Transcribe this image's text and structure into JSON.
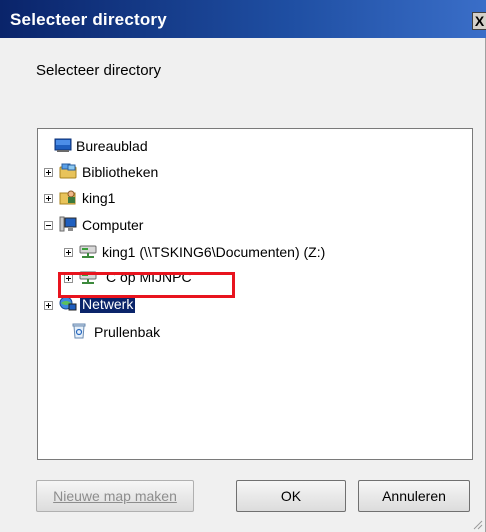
{
  "window": {
    "title": "Selecteer directory",
    "close_glyph": "X"
  },
  "prompt": "Selecteer directory",
  "tree": {
    "items": [
      {
        "label": "Bureaublad",
        "icon": "desktop-icon",
        "expander": "none"
      },
      {
        "label": "Bibliotheken",
        "icon": "libraries-icon",
        "expander": "plus"
      },
      {
        "label": "king1",
        "icon": "user-folder-icon",
        "expander": "plus"
      },
      {
        "label": "Computer",
        "icon": "computer-icon",
        "expander": "minus"
      },
      {
        "label": "king1 (\\\\TSKING6\\Documenten) (Z:)",
        "icon": "network-drive-icon",
        "expander": "plus"
      },
      {
        "label": "C op MIJNPC",
        "icon": "network-drive-icon",
        "expander": "plus"
      },
      {
        "label": "Netwerk",
        "icon": "network-icon",
        "expander": "plus",
        "selected": true
      },
      {
        "label": "Prullenbak",
        "icon": "recycle-bin-icon",
        "expander": "none"
      }
    ]
  },
  "buttons": {
    "new_folder": "Nieuwe map maken",
    "ok": "OK",
    "cancel": "Annuleren"
  },
  "colors": {
    "titlebar": "#0a246a",
    "selection": "#0a246a",
    "highlight_box": "#e8141e"
  }
}
